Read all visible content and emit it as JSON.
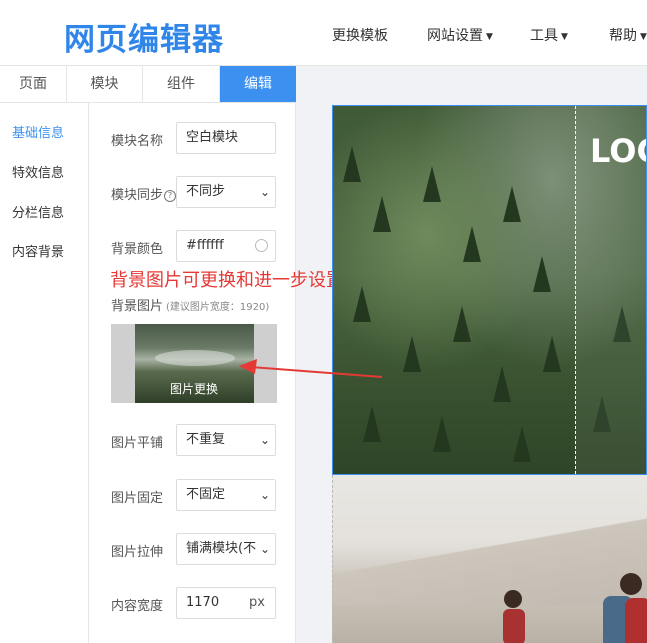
{
  "brand": {
    "logo": "网页编辑器"
  },
  "top_menu": {
    "change_template": "更换模板",
    "site_settings": "网站设置",
    "tools": "工具",
    "help": "帮助"
  },
  "tabs": [
    "页面",
    "模块",
    "组件",
    "编辑"
  ],
  "subnav": [
    "基础信息",
    "特效信息",
    "分栏信息",
    "内容背景"
  ],
  "form": {
    "module_name_label": "模块名称",
    "module_name_value": "空白模块",
    "module_sync_label": "模块同步",
    "module_sync_value": "不同步",
    "bg_color_label": "背景颜色",
    "bg_color_value": "#ffffff",
    "bg_image_label": "背景图片",
    "bg_image_hint": "(建议图片宽度：1920)",
    "image_replace_caption": "图片更换",
    "tile_label": "图片平铺",
    "tile_value": "不重复",
    "fixed_label": "图片固定",
    "fixed_value": "不固定",
    "stretch_label": "图片拉伸",
    "stretch_value": "铺满模块(不",
    "width_label": "内容宽度",
    "width_value": "1170",
    "width_unit": "px"
  },
  "annotation": "背景图片可更换和进一步设置",
  "canvas": {
    "logo_text": "LOG"
  },
  "colors": {
    "accent": "#3c91f0",
    "annotation": "#e53935"
  }
}
